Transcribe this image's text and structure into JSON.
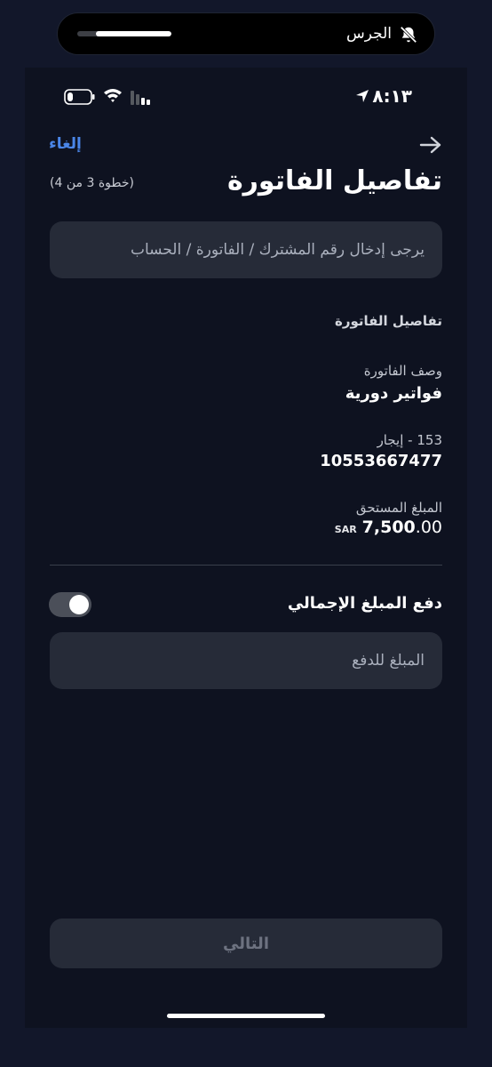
{
  "notification": {
    "label": "الجرس",
    "progress": 0.8,
    "icon": "bell-slash-icon"
  },
  "status_bar": {
    "time": "٨:١٣",
    "icons": [
      "location-arrow-icon",
      "wifi-icon",
      "signal-icon",
      "battery-icon"
    ]
  },
  "nav": {
    "cancel_label": "إلغاء",
    "back_icon": "arrow-right-icon"
  },
  "header": {
    "title": "تفاصيل الفاتورة",
    "step": "(خطوة 3 من 4)"
  },
  "subscriber_input": {
    "placeholder": "يرجى إدخال رقم المشترك / الفاتورة / الحساب",
    "value": ""
  },
  "details": {
    "heading": "تفاصيل الفاتورة",
    "description_label": "وصف الفاتورة",
    "description_value": "فواتير دورية",
    "account_label": "153 - إيجار",
    "account_value": "10553667477",
    "amount_label": "المبلغ المستحق",
    "amount_integer": "7,500",
    "amount_decimal": ".00",
    "currency": "SAR"
  },
  "pay_total": {
    "label": "دفع المبلغ الإجمالي",
    "enabled": true
  },
  "amount_input": {
    "placeholder": "المبلغ للدفع",
    "value": ""
  },
  "footer": {
    "next_label": "التالي"
  },
  "colors": {
    "background": "#0e1220",
    "surface": "#262b38",
    "accent": "#4a86e8",
    "text": "#ffffff"
  }
}
